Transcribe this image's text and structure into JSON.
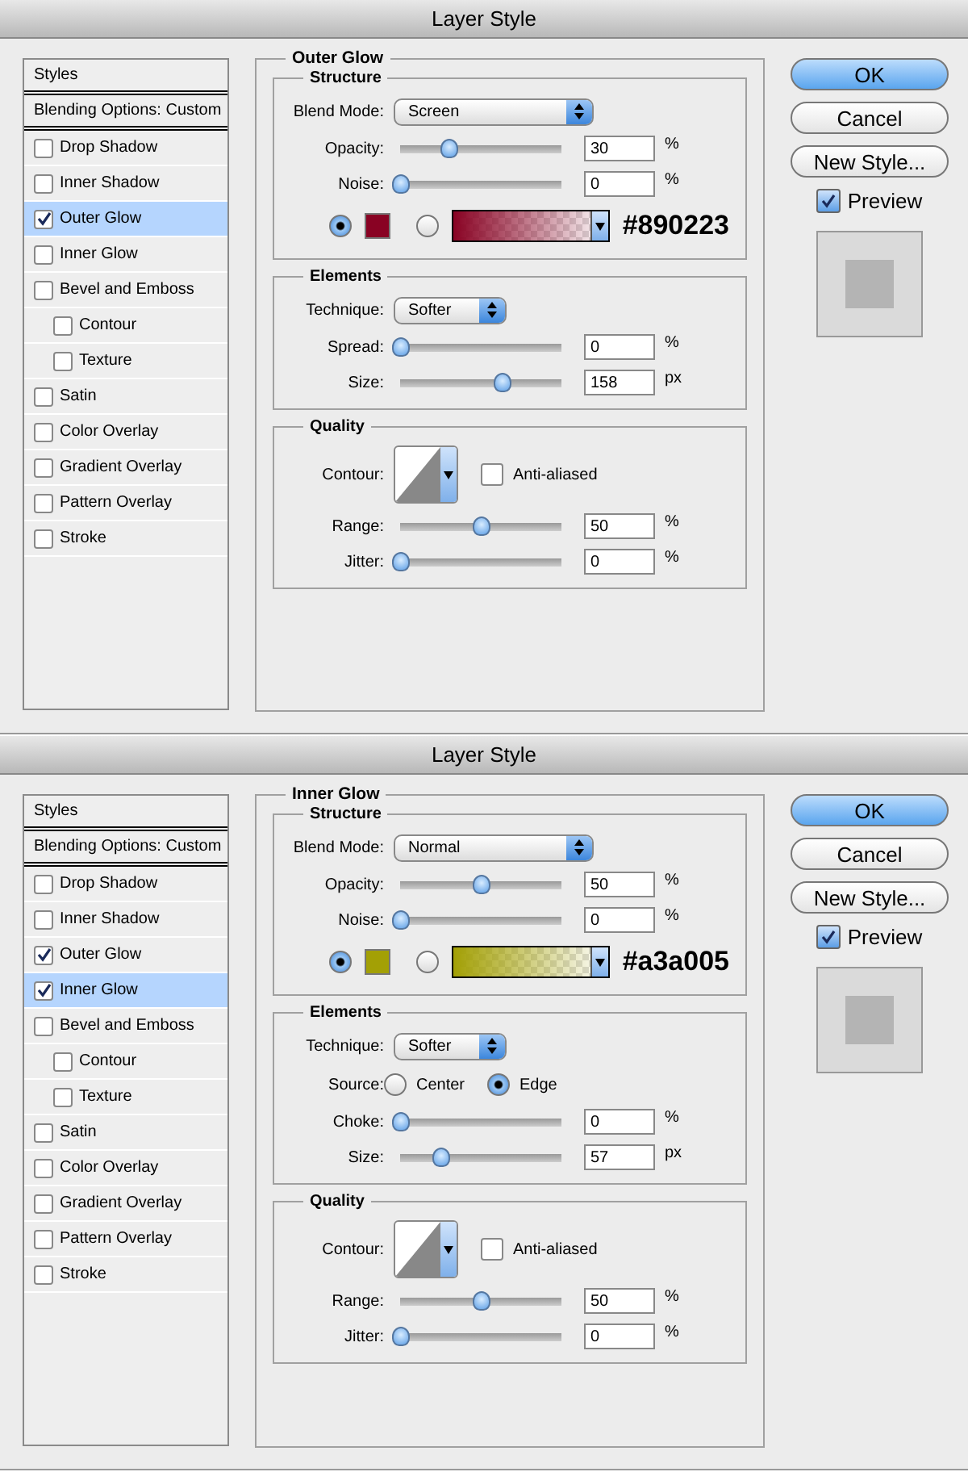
{
  "dialogs": [
    {
      "title": "Layer Style",
      "sidebar": [
        {
          "kind": "header",
          "label": "Styles"
        },
        {
          "kind": "header",
          "label": "Blending Options: Custom"
        },
        {
          "kind": "check",
          "label": "Drop Shadow",
          "checked": false,
          "selected": false
        },
        {
          "kind": "check",
          "label": "Inner Shadow",
          "checked": false,
          "selected": false
        },
        {
          "kind": "check",
          "label": "Outer Glow",
          "checked": true,
          "selected": true
        },
        {
          "kind": "check",
          "label": "Inner Glow",
          "checked": false,
          "selected": false
        },
        {
          "kind": "check",
          "label": "Bevel and Emboss",
          "checked": false,
          "selected": false,
          "children": [
            {
              "kind": "check",
              "label": "Contour",
              "checked": false,
              "selected": false
            },
            {
              "kind": "check",
              "label": "Texture",
              "checked": false,
              "selected": false
            }
          ]
        },
        {
          "kind": "check",
          "label": "Satin",
          "checked": false,
          "selected": false
        },
        {
          "kind": "check",
          "label": "Color Overlay",
          "checked": false,
          "selected": false
        },
        {
          "kind": "check",
          "label": "Gradient Overlay",
          "checked": false,
          "selected": false
        },
        {
          "kind": "check",
          "label": "Pattern Overlay",
          "checked": false,
          "selected": false
        },
        {
          "kind": "check",
          "label": "Stroke",
          "checked": false,
          "selected": false
        }
      ],
      "panel": {
        "title": "Outer Glow",
        "sections": [
          {
            "title": "Structure",
            "rows": [
              {
                "kind": "select",
                "label": "Blend Mode:",
                "value": "Screen",
                "wide": true
              },
              {
                "kind": "slider",
                "label": "Opacity:",
                "level": 0.3,
                "value": "30",
                "unit": "%"
              },
              {
                "kind": "slider",
                "label": "Noise:",
                "level": 0,
                "value": "0",
                "unit": "%"
              },
              {
                "kind": "color",
                "color_selected": true,
                "gradient_selected": false,
                "color": "#890223",
                "caption": "#890223"
              }
            ]
          },
          {
            "title": "Elements",
            "rows": [
              {
                "kind": "select",
                "label": "Technique:",
                "value": "Softer",
                "wide": false
              },
              {
                "kind": "slider",
                "label": "Spread:",
                "level": 0,
                "value": "0",
                "unit": "%"
              },
              {
                "kind": "slider",
                "label": "Size:",
                "level": 0.63,
                "value": "158",
                "unit": "px"
              }
            ]
          },
          {
            "title": "Quality",
            "rows": [
              {
                "kind": "contour",
                "label": "Contour:",
                "option": "Anti-aliased",
                "checked": false
              },
              {
                "kind": "slider",
                "label": "Range:",
                "level": 0.5,
                "value": "50",
                "unit": "%"
              },
              {
                "kind": "slider",
                "label": "Jitter:",
                "level": 0,
                "value": "0",
                "unit": "%"
              }
            ]
          }
        ]
      },
      "buttons": [
        {
          "label": "OK",
          "default": true
        },
        {
          "label": "Cancel",
          "default": false
        },
        {
          "label": "New Style...",
          "default": false
        }
      ],
      "preview": {
        "label": "Preview",
        "checked": true
      }
    },
    {
      "title": "Layer Style",
      "sidebar": [
        {
          "kind": "header",
          "label": "Styles"
        },
        {
          "kind": "header",
          "label": "Blending Options: Custom"
        },
        {
          "kind": "check",
          "label": "Drop Shadow",
          "checked": false,
          "selected": false
        },
        {
          "kind": "check",
          "label": "Inner Shadow",
          "checked": false,
          "selected": false
        },
        {
          "kind": "check",
          "label": "Outer Glow",
          "checked": true,
          "selected": false
        },
        {
          "kind": "check",
          "label": "Inner Glow",
          "checked": true,
          "selected": true
        },
        {
          "kind": "check",
          "label": "Bevel and Emboss",
          "checked": false,
          "selected": false,
          "children": [
            {
              "kind": "check",
              "label": "Contour",
              "checked": false,
              "selected": false
            },
            {
              "kind": "check",
              "label": "Texture",
              "checked": false,
              "selected": false
            }
          ]
        },
        {
          "kind": "check",
          "label": "Satin",
          "checked": false,
          "selected": false
        },
        {
          "kind": "check",
          "label": "Color Overlay",
          "checked": false,
          "selected": false
        },
        {
          "kind": "check",
          "label": "Gradient Overlay",
          "checked": false,
          "selected": false
        },
        {
          "kind": "check",
          "label": "Pattern Overlay",
          "checked": false,
          "selected": false
        },
        {
          "kind": "check",
          "label": "Stroke",
          "checked": false,
          "selected": false
        }
      ],
      "panel": {
        "title": "Inner Glow",
        "sections": [
          {
            "title": "Structure",
            "rows": [
              {
                "kind": "select",
                "label": "Blend Mode:",
                "value": "Normal",
                "wide": true
              },
              {
                "kind": "slider",
                "label": "Opacity:",
                "level": 0.5,
                "value": "50",
                "unit": "%"
              },
              {
                "kind": "slider",
                "label": "Noise:",
                "level": 0,
                "value": "0",
                "unit": "%"
              },
              {
                "kind": "color",
                "color_selected": true,
                "gradient_selected": false,
                "color": "#a3a005",
                "caption": "#a3a005"
              }
            ]
          },
          {
            "title": "Elements",
            "rows": [
              {
                "kind": "select",
                "label": "Technique:",
                "value": "Softer",
                "wide": false
              },
              {
                "kind": "radio",
                "label": "Source:",
                "options": [
                  {
                    "label": "Center",
                    "selected": false
                  },
                  {
                    "label": "Edge",
                    "selected": true
                  }
                ]
              },
              {
                "kind": "slider",
                "label": "Choke:",
                "level": 0,
                "value": "0",
                "unit": "%"
              },
              {
                "kind": "slider",
                "label": "Size:",
                "level": 0.25,
                "value": "57",
                "unit": "px"
              }
            ]
          },
          {
            "title": "Quality",
            "rows": [
              {
                "kind": "contour",
                "label": "Contour:",
                "option": "Anti-aliased",
                "checked": false
              },
              {
                "kind": "slider",
                "label": "Range:",
                "level": 0.5,
                "value": "50",
                "unit": "%"
              },
              {
                "kind": "slider",
                "label": "Jitter:",
                "level": 0,
                "value": "0",
                "unit": "%"
              }
            ]
          }
        ]
      },
      "buttons": [
        {
          "label": "OK",
          "default": true
        },
        {
          "label": "Cancel",
          "default": false
        },
        {
          "label": "New Style...",
          "default": false
        }
      ],
      "preview": {
        "label": "Preview",
        "checked": true
      }
    }
  ]
}
